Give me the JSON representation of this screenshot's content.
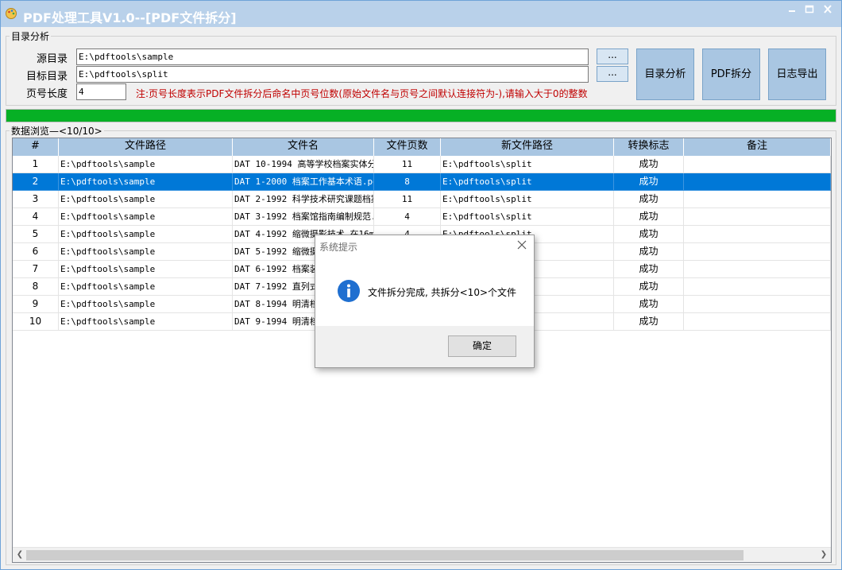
{
  "window": {
    "title": "PDF处理工具V1.0--[PDF文件拆分]"
  },
  "dir_group": {
    "legend": "目录分析",
    "source_label": "源目录",
    "source_value": "E:\\pdftools\\sample",
    "target_label": "目标目录",
    "target_value": "E:\\pdftools\\split",
    "length_label": "页号长度",
    "length_value": "4",
    "note": "注:页号长度表示PDF文件拆分后命名中页号位数(原始文件名与页号之间默认连接符为-),请输入大于0的整数",
    "browse_label": "...",
    "analyze_button": "目录分析",
    "split_button": "PDF拆分",
    "export_button": "日志导出"
  },
  "progress": {
    "percent": 100,
    "color": "#06b025"
  },
  "data_group": {
    "legend": "数据浏览—<10/10>",
    "columns": [
      "#",
      "文件路径",
      "文件名",
      "文件页数",
      "新文件路径",
      "转换标志",
      "备注"
    ],
    "rows": [
      {
        "n": "1",
        "path": "E:\\pdftools\\sample",
        "name": "DAT 10-1994 高等学校档案实体分",
        "pages": "11",
        "newpath": "E:\\pdftools\\split",
        "flag": "成功",
        "note": ""
      },
      {
        "n": "2",
        "path": "E:\\pdftools\\sample",
        "name": "DAT 1-2000 档案工作基本术语.pd",
        "pages": "8",
        "newpath": "E:\\pdftools\\split",
        "flag": "成功",
        "note": ""
      },
      {
        "n": "3",
        "path": "E:\\pdftools\\sample",
        "name": "DAT 2-1992 科学技术研究课题档案",
        "pages": "11",
        "newpath": "E:\\pdftools\\split",
        "flag": "成功",
        "note": ""
      },
      {
        "n": "4",
        "path": "E:\\pdftools\\sample",
        "name": "DAT 3-1992 档案馆指南编制规范.",
        "pages": "4",
        "newpath": "E:\\pdftools\\split",
        "flag": "成功",
        "note": ""
      },
      {
        "n": "5",
        "path": "E:\\pdftools\\sample",
        "name": "DAT 4-1992 缩微摄影技术 在16mm",
        "pages": "4",
        "newpath": "E:\\pdftools\\split",
        "flag": "成功",
        "note": ""
      },
      {
        "n": "6",
        "path": "E:\\pdftools\\sample",
        "name": "DAT 5-1992 缩微摄",
        "pages": "",
        "newpath": "",
        "flag": "成功",
        "note": ""
      },
      {
        "n": "7",
        "path": "E:\\pdftools\\sample",
        "name": "DAT 6-1992 档案装",
        "pages": "",
        "newpath": "",
        "flag": "成功",
        "note": ""
      },
      {
        "n": "8",
        "path": "E:\\pdftools\\sample",
        "name": "DAT 7-1992 直列式",
        "pages": "",
        "newpath": "",
        "flag": "成功",
        "note": ""
      },
      {
        "n": "9",
        "path": "E:\\pdftools\\sample",
        "name": "DAT 8-1994 明清档",
        "pages": "",
        "newpath": "",
        "flag": "成功",
        "note": ""
      },
      {
        "n": "10",
        "path": "E:\\pdftools\\sample",
        "name": "DAT 9-1994 明清档",
        "pages": "",
        "newpath": "",
        "flag": "成功",
        "note": ""
      }
    ],
    "selected_row": 2,
    "selection_color": "#0078d7",
    "header_color": "#a9c6e2"
  },
  "dialog": {
    "title": "系统提示",
    "message": "文件拆分完成, 共拆分<10>个文件",
    "ok_button": "确定",
    "icon": "info-icon"
  }
}
